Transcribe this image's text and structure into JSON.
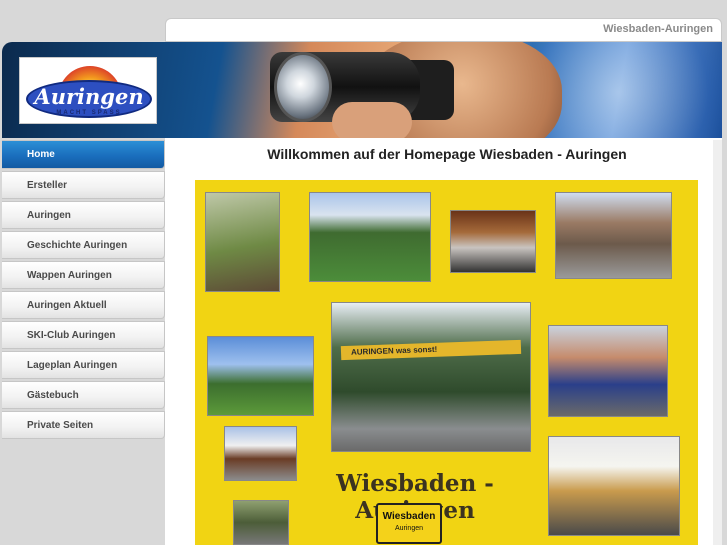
{
  "site": {
    "name": "Wiesbaden-Auringen"
  },
  "logo": {
    "text": "Auringen",
    "subtext": "MACHT SPASS"
  },
  "nav": {
    "items": [
      {
        "label": "Home",
        "active": true
      },
      {
        "label": "Ersteller",
        "active": false
      },
      {
        "label": "Auringen",
        "active": false
      },
      {
        "label": "Geschichte Auringen",
        "active": false
      },
      {
        "label": "Wappen Auringen",
        "active": false
      },
      {
        "label": "Auringen Aktuell",
        "active": false
      },
      {
        "label": "SKI-Club Auringen",
        "active": false
      },
      {
        "label": "Lageplan Auringen",
        "active": false
      },
      {
        "label": "Gästebuch",
        "active": false
      },
      {
        "label": "Private Seiten",
        "active": false
      }
    ]
  },
  "main": {
    "title": "Willkommen auf der Homepage Wiesbaden - Auringen"
  },
  "collage": {
    "banner": "AURINGEN  was sonst!",
    "title": "Wiesbaden - Auringen",
    "sign_city": "Wiesbaden",
    "sign_district": "Auringen"
  },
  "colors": {
    "nav_active": "#1a6ebd",
    "collage_background": "#f1d413",
    "page_background": "#d8d8d8"
  }
}
